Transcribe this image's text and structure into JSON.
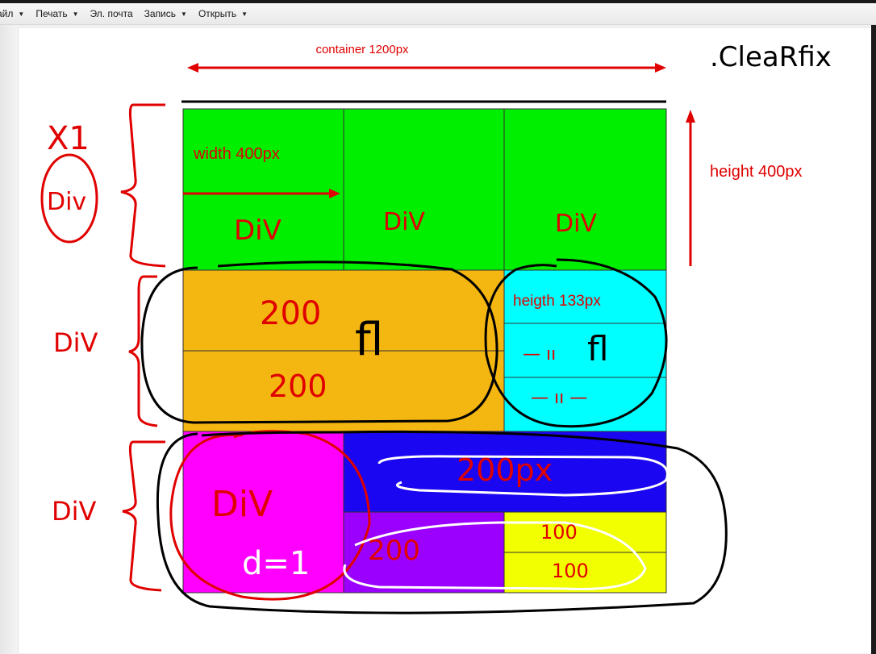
{
  "toolbar": {
    "items": [
      {
        "label": "айл",
        "has_menu": true
      },
      {
        "label": "Печать",
        "has_menu": true
      },
      {
        "label": "Эл. почта",
        "has_menu": false
      },
      {
        "label": "Запись",
        "has_menu": true
      },
      {
        "label": "Открыть",
        "has_menu": true
      }
    ],
    "caret": "▼"
  },
  "diagram": {
    "container_label": "container 1200px",
    "clearfix_label": ".CleaRfix",
    "width_label": "width 400px",
    "height_label": "height 400px",
    "heigth_label": "heigth 133px",
    "row1_div": [
      "DiV",
      "DiV",
      "DiV"
    ],
    "x1_label": "X1",
    "div_left_1": "Div",
    "div_left_2": "DiV",
    "div_left_3": "DiV",
    "orange_top": "200",
    "orange_bottom": "200",
    "fl_1": "fl",
    "fl_2": "fl",
    "cyan_mid_mark": "— ıı",
    "cyan_bottom_mark": "— ıı —",
    "blue_label": "200px",
    "magenta_div": "DiV",
    "magenta_note": "d=1",
    "purple_label": "200",
    "yellow_top": "100",
    "yellow_bottom": "100"
  },
  "colors": {
    "green": "#00ee00",
    "orange": "#f4b610",
    "cyan": "#00ffff",
    "magenta": "#ff00ff",
    "blue": "#1a06f0",
    "purple": "#9b00ff",
    "yellow": "#f2ff00",
    "annotation_red": "#e00000",
    "ink": "#000000"
  }
}
